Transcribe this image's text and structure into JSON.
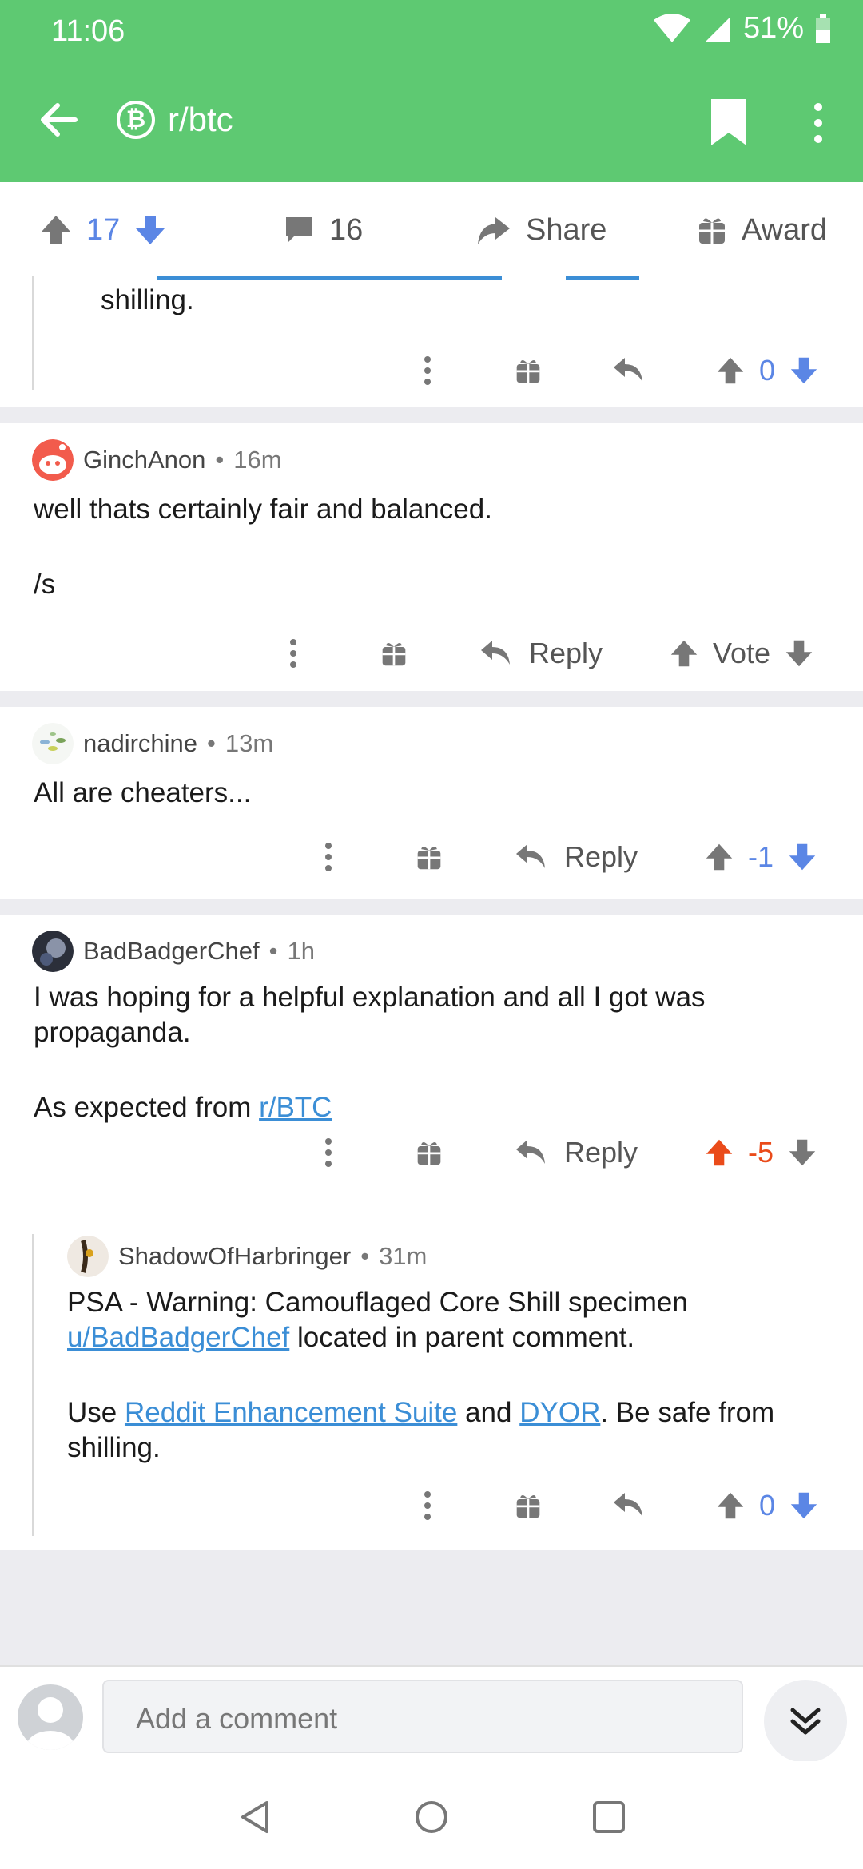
{
  "status": {
    "time": "11:06",
    "battery": "51%"
  },
  "header": {
    "subreddit": "r/btc",
    "badge_symbol": "₿"
  },
  "post_actions": {
    "score": "17",
    "comments": "16",
    "share_label": "Share",
    "award_label": "Award"
  },
  "previous_comment_tail": {
    "text": "shilling.",
    "score": "0"
  },
  "comments": [
    {
      "author": "GinchAnon",
      "age": "16m",
      "body": [
        "well thats certainly fair and balanced.",
        "/s"
      ],
      "reply_label": "Reply",
      "vote_label": "Vote"
    },
    {
      "author": "nadirchine",
      "age": "13m",
      "body": [
        "All are cheaters..."
      ],
      "reply_label": "Reply",
      "score": "-1"
    },
    {
      "author": "BadBadgerChef",
      "age": "1h",
      "body_line1": "I was hoping for a helpful explanation and all I got was propaganda.",
      "body_line2_prefix": "As expected from ",
      "body_link": "r/BTC",
      "reply_label": "Reply",
      "score": "-5"
    }
  ],
  "nested_reply": {
    "author": "ShadowOfHarbringer",
    "age": "31m",
    "p1_prefix": "PSA - Warning: Camouflaged Core Shill specimen ",
    "p1_link": "u/BadBadgerChef",
    "p1_suffix": " located in parent comment.",
    "p2_prefix": "Use ",
    "p2_link1": "Reddit Enhancement Suite",
    "p2_mid": " and ",
    "p2_link2": "DYOR",
    "p2_suffix": ". Be safe from shilling.",
    "score": "0"
  },
  "composer": {
    "placeholder": "Add a comment"
  },
  "colors": {
    "app_bar": "#5ec972",
    "upvote_orange": "#ea4b1a",
    "downvote_blue": "#5b86e5",
    "link": "#3b8ed6"
  },
  "separator": "•"
}
